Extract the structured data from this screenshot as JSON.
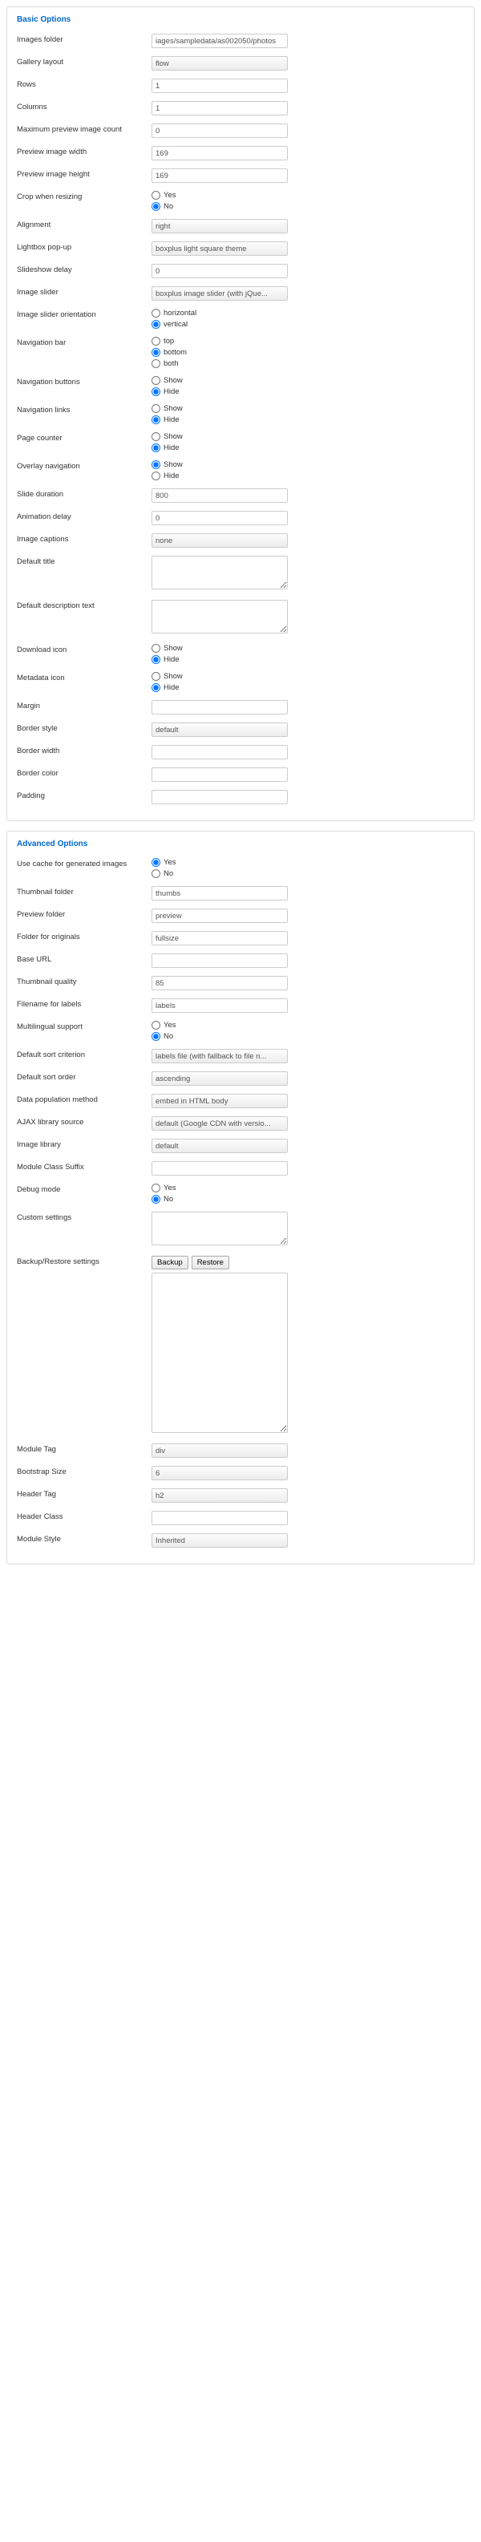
{
  "basic": {
    "title": "Basic Options",
    "images_folder": {
      "label": "Images folder",
      "value": "iages/sampledata/as002050/photos"
    },
    "gallery_layout": {
      "label": "Gallery layout",
      "value": "flow"
    },
    "rows": {
      "label": "Rows",
      "value": "1"
    },
    "columns": {
      "label": "Columns",
      "value": "1"
    },
    "max_preview_count": {
      "label": "Maximum preview image count",
      "value": "0"
    },
    "preview_width": {
      "label": "Preview image width",
      "value": "169"
    },
    "preview_height": {
      "label": "Preview image height",
      "value": "169"
    },
    "crop": {
      "label": "Crop when resizing",
      "options": [
        "Yes",
        "No"
      ],
      "selected": "No"
    },
    "alignment": {
      "label": "Alignment",
      "value": "right"
    },
    "lightbox": {
      "label": "Lightbox pop-up",
      "value": "boxplus light square theme"
    },
    "slideshow_delay": {
      "label": "Slideshow delay",
      "value": "0"
    },
    "image_slider": {
      "label": "Image slider",
      "value": "boxplus image slider (with jQue..."
    },
    "slider_orientation": {
      "label": "Image slider orientation",
      "options": [
        "horizontal",
        "vertical"
      ],
      "selected": "vertical"
    },
    "nav_bar": {
      "label": "Navigation bar",
      "options": [
        "top",
        "bottom",
        "both"
      ],
      "selected": "bottom"
    },
    "nav_buttons": {
      "label": "Navigation buttons",
      "options": [
        "Show",
        "Hide"
      ],
      "selected": "Hide"
    },
    "nav_links": {
      "label": "Navigation links",
      "options": [
        "Show",
        "Hide"
      ],
      "selected": "Hide"
    },
    "page_counter": {
      "label": "Page counter",
      "options": [
        "Show",
        "Hide"
      ],
      "selected": "Hide"
    },
    "overlay_nav": {
      "label": "Overlay navigation",
      "options": [
        "Show",
        "Hide"
      ],
      "selected": "Show"
    },
    "slide_duration": {
      "label": "Slide duration",
      "value": "800"
    },
    "animation_delay": {
      "label": "Animation delay",
      "value": "0"
    },
    "image_captions": {
      "label": "Image captions",
      "value": "none"
    },
    "default_title": {
      "label": "Default title",
      "value": ""
    },
    "default_desc": {
      "label": "Default description text",
      "value": ""
    },
    "download_icon": {
      "label": "Download icon",
      "options": [
        "Show",
        "Hide"
      ],
      "selected": "Hide"
    },
    "metadata_icon": {
      "label": "Metadata icon",
      "options": [
        "Show",
        "Hide"
      ],
      "selected": "Hide"
    },
    "margin": {
      "label": "Margin",
      "value": ""
    },
    "border_style": {
      "label": "Border style",
      "value": "default"
    },
    "border_width": {
      "label": "Border width",
      "value": ""
    },
    "border_color": {
      "label": "Border color",
      "value": ""
    },
    "padding": {
      "label": "Padding",
      "value": ""
    }
  },
  "advanced": {
    "title": "Advanced Options",
    "use_cache": {
      "label": "Use cache for generated images",
      "options": [
        "Yes",
        "No"
      ],
      "selected": "Yes"
    },
    "thumb_folder": {
      "label": "Thumbnail folder",
      "value": "thumbs"
    },
    "preview_folder": {
      "label": "Preview folder",
      "value": "preview"
    },
    "originals_folder": {
      "label": "Folder for originals",
      "value": "fullsize"
    },
    "base_url": {
      "label": "Base URL",
      "value": ""
    },
    "thumb_quality": {
      "label": "Thumbnail quality",
      "value": "85"
    },
    "filename_labels": {
      "label": "Filename for labels",
      "value": "labels"
    },
    "multilingual": {
      "label": "Multilingual support",
      "options": [
        "Yes",
        "No"
      ],
      "selected": "No"
    },
    "sort_criterion": {
      "label": "Default sort criterion",
      "value": "labels file (with fallback to file n..."
    },
    "sort_order": {
      "label": "Default sort order",
      "value": "ascending"
    },
    "data_population": {
      "label": "Data population method",
      "value": "embed in HTML body"
    },
    "ajax_source": {
      "label": "AJAX library source",
      "value": "default (Google CDN with versio..."
    },
    "image_library": {
      "label": "Image library",
      "value": "default"
    },
    "module_class_suffix": {
      "label": "Module Class Suffix",
      "value": ""
    },
    "debug_mode": {
      "label": "Debug mode",
      "options": [
        "Yes",
        "No"
      ],
      "selected": "No"
    },
    "custom_settings": {
      "label": "Custom settings",
      "value": ""
    },
    "backup_restore": {
      "label": "Backup/Restore settings",
      "backup": "Backup",
      "restore": "Restore",
      "value": ""
    },
    "module_tag": {
      "label": "Module Tag",
      "value": "div"
    },
    "bootstrap_size": {
      "label": "Bootstrap Size",
      "value": "6"
    },
    "header_tag": {
      "label": "Header Tag",
      "value": "h2"
    },
    "header_class": {
      "label": "Header Class",
      "value": ""
    },
    "module_style": {
      "label": "Module Style",
      "value": "Inherited"
    }
  }
}
